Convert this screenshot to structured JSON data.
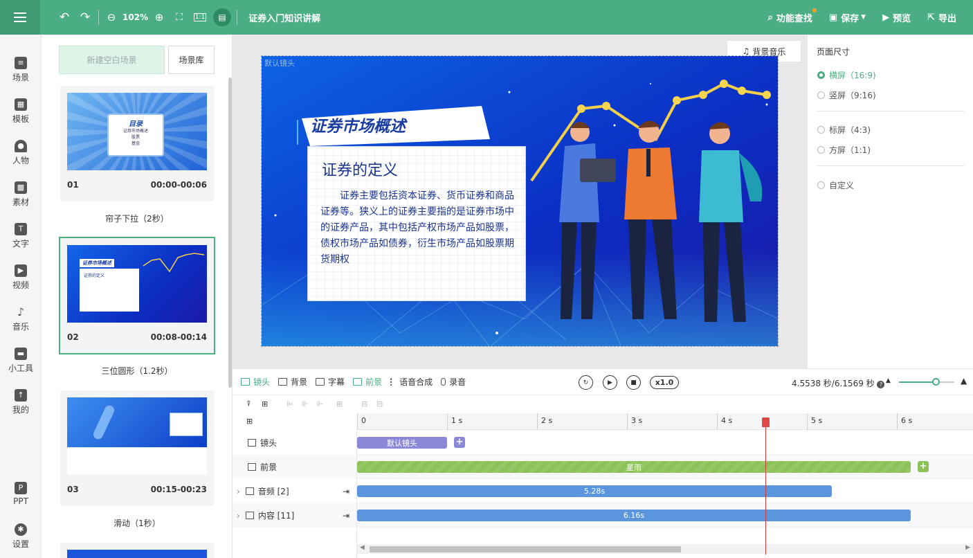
{
  "topbar": {
    "zoom": "102%",
    "doc_title": "证券入门知识讲解",
    "actions": {
      "find": "功能查找",
      "save": "保存",
      "preview": "预览",
      "export": "导出"
    }
  },
  "nav": [
    {
      "label": "场景"
    },
    {
      "label": "模板"
    },
    {
      "label": "人物"
    },
    {
      "label": "素材"
    },
    {
      "label": "文字"
    },
    {
      "label": "视频"
    },
    {
      "label": "音乐"
    },
    {
      "label": "小工具"
    },
    {
      "label": "我的"
    },
    {
      "label": "PPT"
    },
    {
      "label": "设置"
    }
  ],
  "scenes": {
    "new_blank": "新建空白场景",
    "library": "场景库",
    "items": [
      {
        "num": "01",
        "time": "00:00-00:06",
        "transition": "帘子下拉（2秒）",
        "thumb_title": "目录",
        "thumb_lines": [
          "证券市场概述",
          "股票",
          "基金"
        ]
      },
      {
        "num": "02",
        "time": "00:08-00:14",
        "transition": "三位圆形（1.2秒）",
        "thumb_title": "证券市场概述",
        "thumb_sub": "证券的定义"
      },
      {
        "num": "03",
        "time": "00:15-00:23",
        "transition": "滑动（1秒）"
      }
    ]
  },
  "canvas": {
    "music_btn": "背景音乐",
    "lens_label": "默认镜头",
    "title": "证券市场概述",
    "card_heading": "证券的定义",
    "card_text": "证券主要包括资本证券、货币证券和商品证券等。狭义上的证券主要指的是证券市场中的证券产品，其中包括产权市场产品如股票，债权市场产品如债券，衍生市场产品如股票期货期权"
  },
  "page_size": {
    "title": "页面尺寸",
    "options": [
      {
        "label": "横屏（16:9)",
        "selected": true
      },
      {
        "label": "竖屏（9:16)",
        "selected": false
      },
      {
        "label": "标屏（4:3)",
        "selected": false
      },
      {
        "label": "方屏（1:1)",
        "selected": false
      },
      {
        "label": "自定义",
        "selected": false
      }
    ]
  },
  "timeline": {
    "tabs": [
      "镜头",
      "背景",
      "字幕",
      "前景",
      "语音合成",
      "录音"
    ],
    "speed": "x1.0",
    "time": "4.5538 秒/6.1569 秒",
    "ticks": [
      "0",
      "1 s",
      "2 s",
      "3 s",
      "4 s",
      "5 s",
      "6 s"
    ],
    "tracks": [
      {
        "label": "镜头",
        "clip": "默认镜头"
      },
      {
        "label": "前景",
        "clip": "星雨"
      },
      {
        "label": "音频 [2]",
        "clip": "5.28s"
      },
      {
        "label": "内容 [11]",
        "clip": "6.16s"
      }
    ],
    "playhead_seconds": 4.5538,
    "zoom_level": 0.66
  },
  "colors": {
    "brand": "#4aad84",
    "clip_blue": "#5b95de",
    "clip_green": "#8cc159",
    "clip_purple": "#8c88d8"
  }
}
